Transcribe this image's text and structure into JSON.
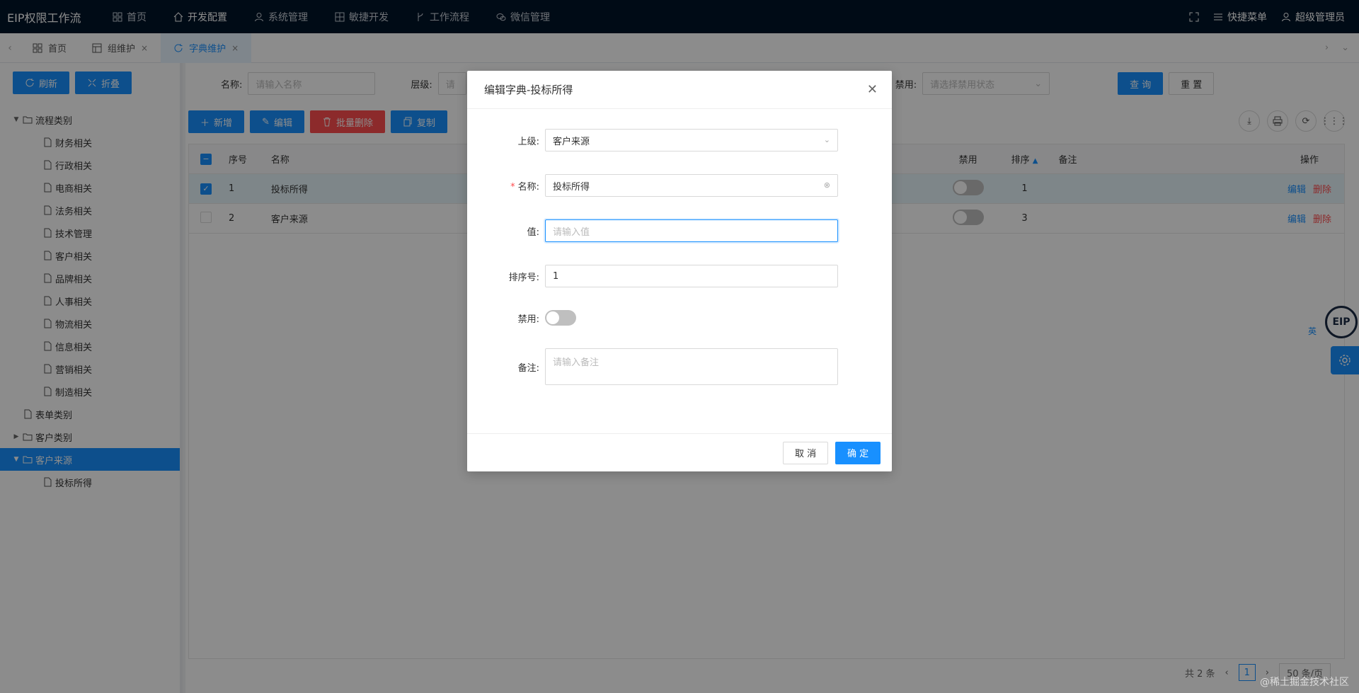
{
  "app": {
    "title": "EIP权限工作流"
  },
  "topmenu": [
    {
      "label": "首页",
      "icon": "dashboard-icon"
    },
    {
      "label": "开发配置",
      "icon": "home-icon",
      "active": true
    },
    {
      "label": "系统管理",
      "icon": "user-icon"
    },
    {
      "label": "敏捷开发",
      "icon": "grid-icon"
    },
    {
      "label": "工作流程",
      "icon": "branch-icon"
    },
    {
      "label": "微信管理",
      "icon": "wechat-icon"
    }
  ],
  "topright": {
    "quick_menu": "快捷菜单",
    "user": "超级管理员"
  },
  "tabs": [
    {
      "label": "首页"
    },
    {
      "label": "组维护"
    },
    {
      "label": "字典维护",
      "active": true
    }
  ],
  "left": {
    "refresh": "刷新",
    "collapse": "折叠",
    "tree": [
      {
        "label": "流程类别",
        "level": 0,
        "folder": true,
        "expanded": true
      },
      {
        "label": "财务相关",
        "level": 1
      },
      {
        "label": "行政相关",
        "level": 1
      },
      {
        "label": "电商相关",
        "level": 1
      },
      {
        "label": "法务相关",
        "level": 1
      },
      {
        "label": "技术管理",
        "level": 1
      },
      {
        "label": "客户相关",
        "level": 1
      },
      {
        "label": "品牌相关",
        "level": 1
      },
      {
        "label": "人事相关",
        "level": 1
      },
      {
        "label": "物流相关",
        "level": 1
      },
      {
        "label": "信息相关",
        "level": 1
      },
      {
        "label": "营销相关",
        "level": 1
      },
      {
        "label": "制造相关",
        "level": 1
      },
      {
        "label": "表单类别",
        "level": 0
      },
      {
        "label": "客户类别",
        "level": 0,
        "folder": true,
        "expanded": false
      },
      {
        "label": "客户来源",
        "level": 0,
        "folder": true,
        "expanded": true,
        "selected": true
      },
      {
        "label": "投标所得",
        "level": 1
      }
    ]
  },
  "filters": {
    "name_label": "名称:",
    "name_placeholder": "请输入名称",
    "level_label": "层级:",
    "level_placeholder": "请",
    "disabled_label": "禁用:",
    "disabled_placeholder": "请选择禁用状态",
    "query": "查 询",
    "reset": "重 置"
  },
  "toolbar": {
    "add": "新增",
    "edit": "编辑",
    "batch_delete": "批量删除",
    "copy": "复制"
  },
  "table": {
    "headers": {
      "index": "序号",
      "name": "名称",
      "disabled": "禁用",
      "sort": "排序",
      "remark": "备注",
      "ops": "操作"
    },
    "rows": [
      {
        "index": "1",
        "name": "投标所得",
        "sort": "1",
        "selected": true
      },
      {
        "index": "2",
        "name": "客户来源",
        "sort": "3",
        "selected": false
      }
    ],
    "edit": "编辑",
    "delete": "删除"
  },
  "pager": {
    "total": "共 2 条",
    "page": "1",
    "size": "50 条/页"
  },
  "float": {
    "lang": "英",
    "logo": "EIP"
  },
  "dialog": {
    "title": "编辑字典-投标所得",
    "parent_label": "上级:",
    "parent_value": "客户来源",
    "name_label": "名称:",
    "name_value": "投标所得",
    "value_label": "值:",
    "value_placeholder": "请输入值",
    "sort_label": "排序号:",
    "sort_value": "1",
    "disabled_label": "禁用:",
    "remark_label": "备注:",
    "remark_placeholder": "请输入备注",
    "cancel": "取 消",
    "ok": "确 定"
  },
  "watermark": "@稀土掘金技术社区"
}
